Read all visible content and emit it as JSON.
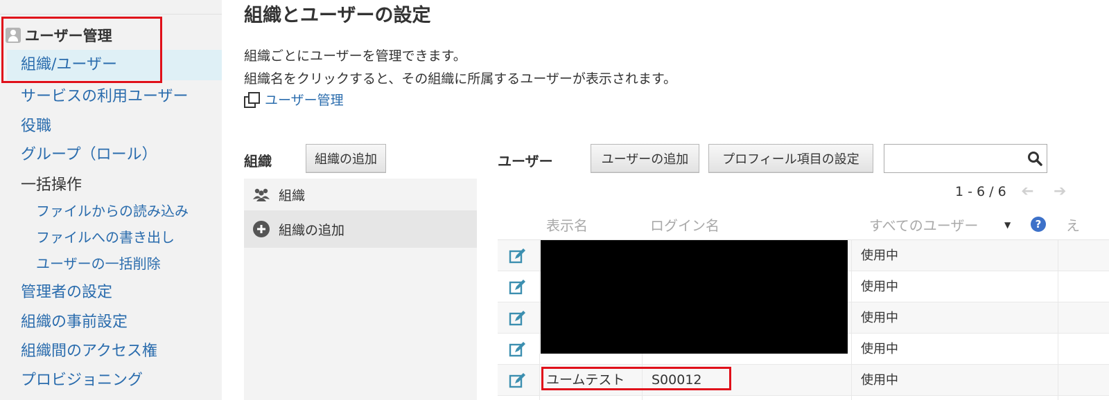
{
  "sidebar": {
    "header": "ユーザー管理",
    "items": [
      {
        "label": "組織/ユーザー"
      },
      {
        "label": "サービスの利用ユーザー"
      },
      {
        "label": "役職"
      },
      {
        "label": "グループ（ロール）"
      },
      {
        "label": "一括操作"
      },
      {
        "label": "ファイルからの読み込み"
      },
      {
        "label": "ファイルへの書き出し"
      },
      {
        "label": "ユーザーの一括削除"
      },
      {
        "label": "管理者の設定"
      },
      {
        "label": "組織の事前設定"
      },
      {
        "label": "組織間のアクセス権"
      },
      {
        "label": "プロビジョニング"
      }
    ]
  },
  "main": {
    "title": "組織とユーザーの設定",
    "desc1": "組織ごとにユーザーを管理できます。",
    "desc2": "組織名をクリックすると、その組織に所属するユーザーが表示されます。",
    "user_admin_link": "ユーザー管理"
  },
  "org": {
    "label": "組織",
    "add_button": "組織の追加",
    "rows": [
      {
        "label": "組織",
        "icon": "people-icon"
      },
      {
        "label": "組織の追加",
        "icon": "plus-circle-icon"
      }
    ]
  },
  "users": {
    "label": "ユーザー",
    "add_button": "ユーザーの追加",
    "profile_button": "プロフィール項目の設定",
    "search_placeholder": "",
    "pager": "1 - 6 / 6",
    "columns": {
      "display_name": "表示名",
      "login_name": "ログイン名",
      "filter": "すべてのユーザー",
      "cut": "え"
    },
    "rows": [
      {
        "display_name": "",
        "login_name": "",
        "status": "使用中"
      },
      {
        "display_name": "",
        "login_name": "",
        "status": "使用中"
      },
      {
        "display_name": "",
        "login_name": "",
        "status": "使用中"
      },
      {
        "display_name": "",
        "login_name": "",
        "status": "使用中"
      },
      {
        "display_name": "ユームテスト",
        "login_name": "S00012",
        "status": "使用中"
      }
    ]
  },
  "colors": {
    "link": "#2a6cad",
    "highlight_box": "#e0101a",
    "active_bg": "#dff0f6",
    "edit_icon": "#3c8fb0"
  }
}
